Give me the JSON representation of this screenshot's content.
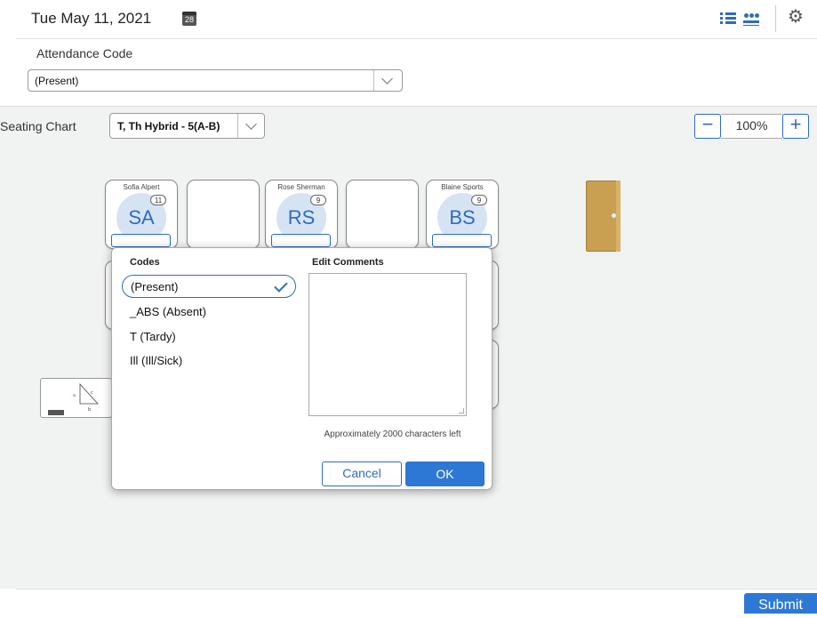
{
  "header": {
    "date": "Tue May 11, 2021",
    "calendar_day": "28"
  },
  "attendance": {
    "label": "Attendance Code",
    "selected": "(Present)"
  },
  "seating": {
    "label": "Seating Chart",
    "selected": "T, Th Hybrid - 5(A-B)",
    "zoom": "100%",
    "zoom_minus": "−",
    "zoom_plus": "+"
  },
  "seats": [
    {
      "name": "Sofia Alpert",
      "initials": "SA",
      "count": "11"
    },
    {
      "name": "Rose Sherman",
      "initials": "RS",
      "count": "9"
    },
    {
      "name": "Blaine Sports",
      "initials": "BS",
      "count": "9"
    }
  ],
  "modal": {
    "codes_header": "Codes",
    "comments_header": "Edit Comments",
    "codes": [
      "(Present)",
      "_ABS (Absent)",
      "T (Tardy)",
      "Ill (Ill/Sick)"
    ],
    "chars_left": "Approximately 2000 characters left",
    "cancel": "Cancel",
    "ok": "OK"
  },
  "submit": "Submit",
  "colors": {
    "accent": "#2d6cc0",
    "primary_button": "#2d78d4",
    "panel_bg": "#f1f2f2",
    "door": "#c9a052"
  }
}
